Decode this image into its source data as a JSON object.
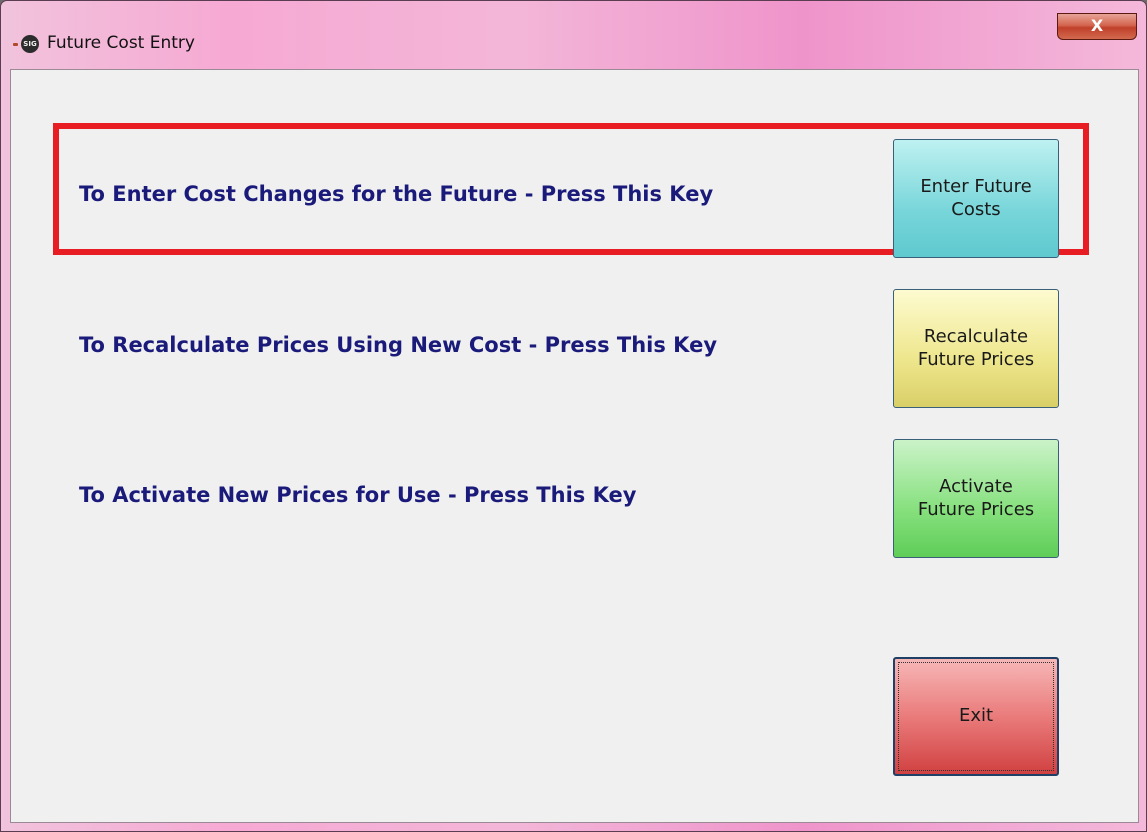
{
  "window": {
    "title": "Future Cost Entry",
    "icon_label": "SIG",
    "close_label": "X"
  },
  "rows": [
    {
      "label": "To Enter Cost Changes for the Future - Press This Key",
      "button_line1": "Enter Future",
      "button_line2": "Costs"
    },
    {
      "label": "To Recalculate Prices Using New Cost - Press This Key",
      "button_line1": "Recalculate",
      "button_line2": "Future Prices"
    },
    {
      "label": "To Activate New Prices for Use - Press This Key",
      "button_line1": "Activate",
      "button_line2": "Future Prices"
    }
  ],
  "exit_button": {
    "label": "Exit"
  },
  "colors": {
    "title_gradient": "#f6a9d3",
    "label_text": "#1a1a7a",
    "highlight_border": "#e81d23",
    "enter_button": "#78d6da",
    "recalculate_button": "#eee68c",
    "activate_button": "#86e07d",
    "exit_button": "#ea7b7b"
  }
}
